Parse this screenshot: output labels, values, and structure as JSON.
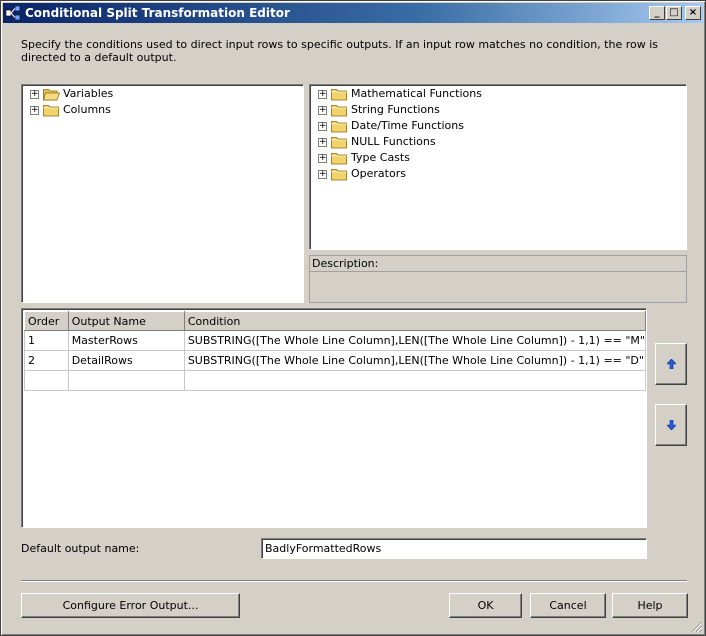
{
  "window": {
    "title": "Conditional Split Transformation Editor",
    "minimize_glyph": "_",
    "maximize_glyph": "□",
    "close_glyph": "×"
  },
  "instructions": "Specify the conditions used to direct input rows to specific outputs. If an input row matches no condition, the row is directed to a default output.",
  "left_tree": {
    "items": [
      {
        "label": "Variables",
        "icon": "folder-open-icon"
      },
      {
        "label": "Columns",
        "icon": "folder-icon"
      }
    ]
  },
  "right_tree": {
    "items": [
      {
        "label": "Mathematical Functions",
        "icon": "folder-icon"
      },
      {
        "label": "String Functions",
        "icon": "folder-icon"
      },
      {
        "label": "Date/Time Functions",
        "icon": "folder-icon"
      },
      {
        "label": "NULL Functions",
        "icon": "folder-icon"
      },
      {
        "label": "Type Casts",
        "icon": "folder-icon"
      },
      {
        "label": "Operators",
        "icon": "folder-icon"
      }
    ]
  },
  "description": {
    "label": "Description:"
  },
  "grid": {
    "columns": [
      "Order",
      "Output Name",
      "Condition"
    ],
    "rows": [
      [
        "1",
        "MasterRows",
        "SUBSTRING([The Whole Line Column],LEN([The Whole Line Column]) - 1,1) == \"M\""
      ],
      [
        "2",
        "DetailRows",
        "SUBSTRING([The Whole Line Column],LEN([The Whole Line Column]) - 1,1) == \"D\""
      ]
    ]
  },
  "default_output": {
    "label": "Default output name:",
    "value": "BadlyFormattedRows"
  },
  "buttons": {
    "configure_error": "Configure Error Output...",
    "ok": "OK",
    "cancel": "Cancel",
    "help": "Help"
  },
  "colors": {
    "dialog_bg": "#d4d0c8",
    "title_bar": "#0a246a",
    "folder": "#f2d26b",
    "arrow": "#2a5ad6"
  }
}
